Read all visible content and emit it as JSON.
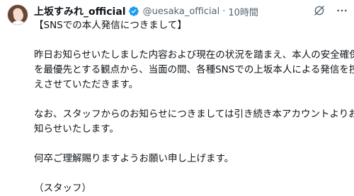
{
  "author": {
    "name": "上坂すみれ_official",
    "handle": "@uesaka_official",
    "separator": "·",
    "time": "10時間"
  },
  "post": {
    "title": "【SNSでの本人発信につきまして】",
    "p1_line1": "昨日お知らせいたしました内容および現在の状況を踏まえ、本人の安全確保",
    "p1_line2": "を最優先とする観点から、当面の間、各種SNSでの上坂本人による発信を控",
    "p1_line3": "えさせていただきます。",
    "p2_line1": "なお、スタッフからのお知らせにつきましては引き続き本アカウントよりお",
    "p2_line2": "知らせいたします。",
    "p3_line1": "何卒ご理解賜りますようお願い申し上げます。",
    "signature": "（スタッフ）"
  },
  "icons": {
    "verified": "verified-badge-icon",
    "grok": "grok-icon",
    "more": "more-icon",
    "accent": "#1d9bf0"
  }
}
